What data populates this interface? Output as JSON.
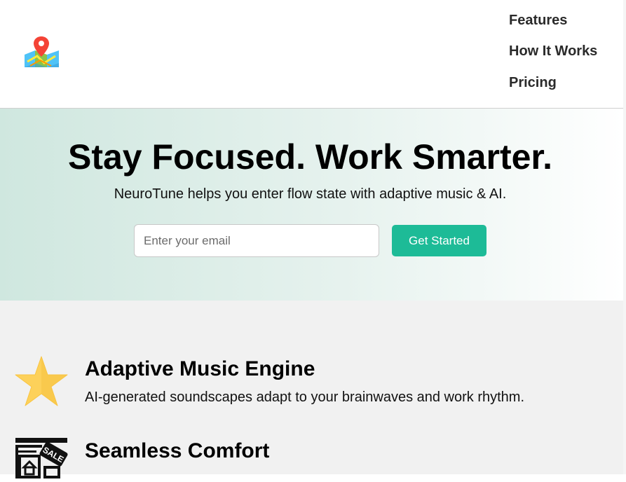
{
  "header": {
    "logo_icon": "map-pin-icon",
    "nav": [
      {
        "label": "Features"
      },
      {
        "label": "How It Works"
      },
      {
        "label": "Pricing"
      }
    ]
  },
  "hero": {
    "title": "Stay Focused. Work Smarter.",
    "subtitle": "NeuroTune helps you enter flow state with adaptive music & AI.",
    "email_placeholder": "Enter your email",
    "email_value": "",
    "cta_label": "Get Started"
  },
  "features": [
    {
      "icon": "star-icon",
      "title": "Adaptive Music Engine",
      "description": "AI-generated soundscapes adapt to your brainwaves and work rhythm."
    },
    {
      "icon": "sale-tag-icon",
      "title": "Seamless Comfort",
      "description": ""
    }
  ],
  "colors": {
    "accent": "#1dbb97",
    "hero_gradient_start": "#cfe7df",
    "hero_gradient_end": "#ffffff",
    "features_bg": "#f1f1f1",
    "nav_text": "#2a2a2a"
  }
}
